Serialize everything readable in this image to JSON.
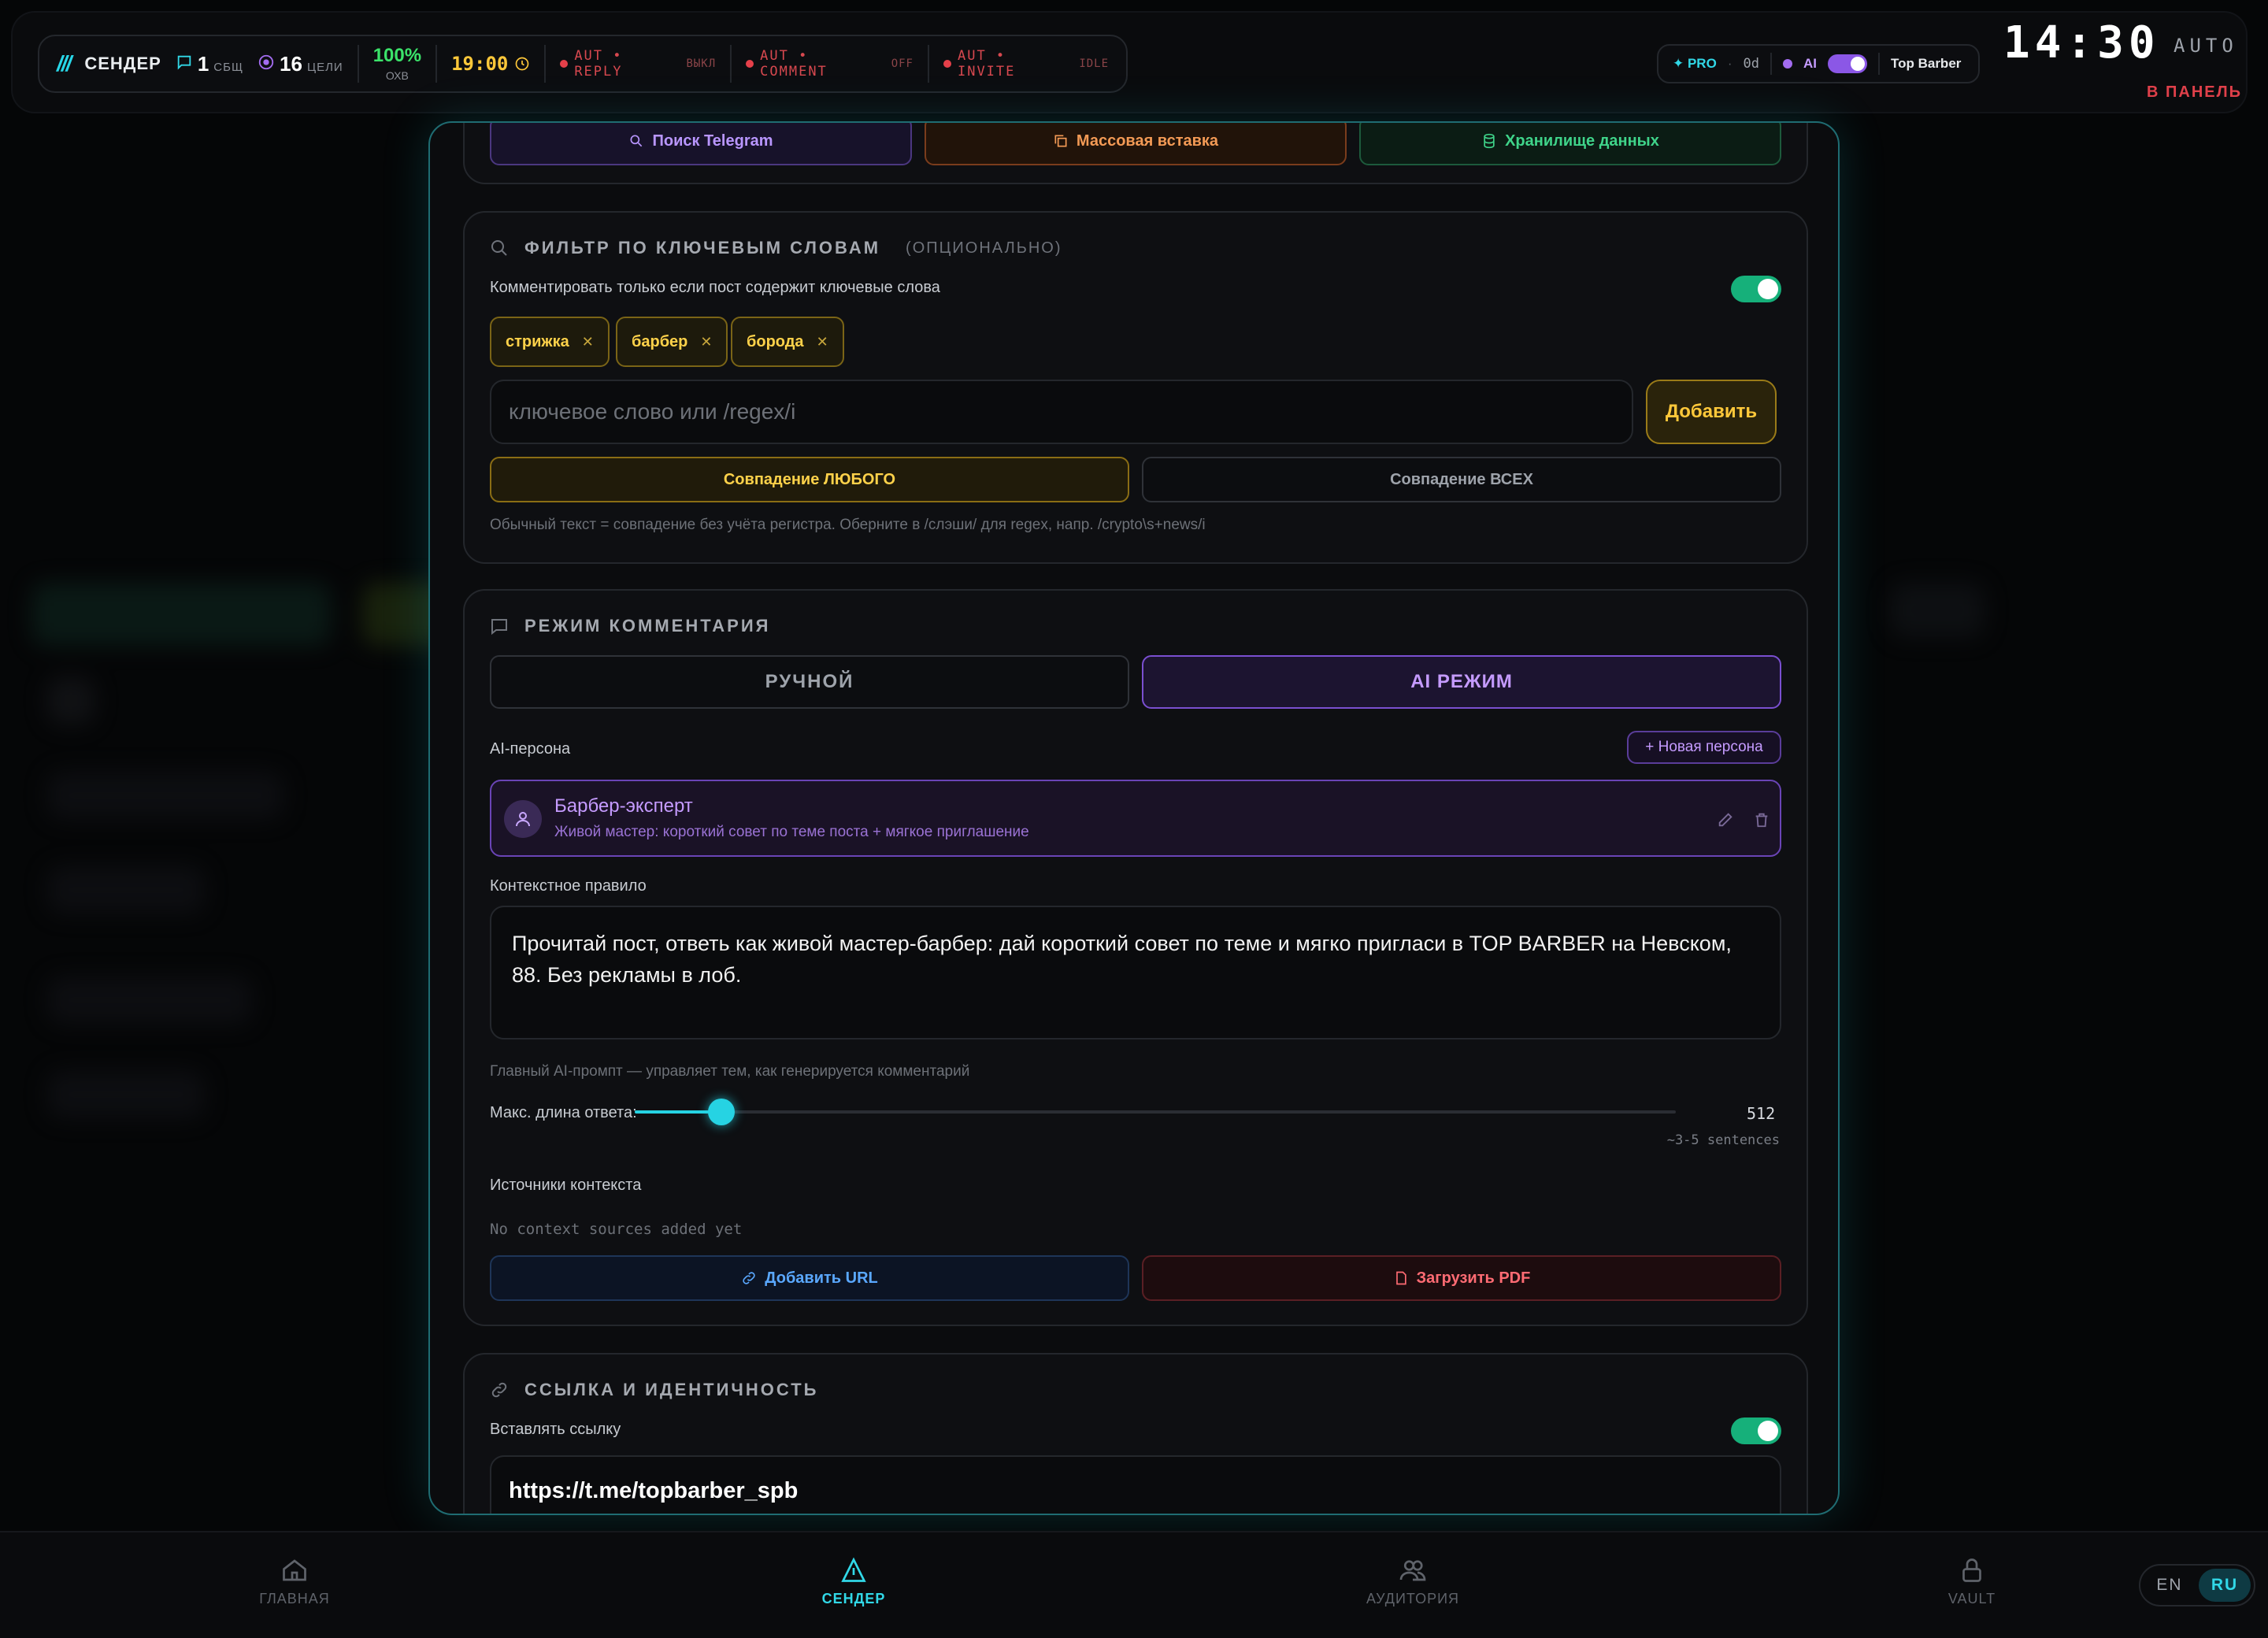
{
  "topbar": {
    "brand_slash": "///",
    "brand": "СЕНДЕР",
    "messages_count": "1",
    "messages_label": "СБЩ",
    "targets_count": "16",
    "targets_label": "ЦЕЛИ",
    "reach_value": "100%",
    "reach_label": "ОХВ",
    "time": "19:00",
    "autos": [
      {
        "label": "AUT • REPLY",
        "state": "ВЫКЛ"
      },
      {
        "label": "AUT • COMMENT",
        "state": "OFF"
      },
      {
        "label": "AUT • INVITE",
        "state": "IDLE"
      }
    ],
    "pro_label": "✦ PRO",
    "pro_days": "0d",
    "ai_label": "AI",
    "account": "Top Barber",
    "clock": "14:30",
    "auto_label": "AUTO",
    "to_panel": "В ПАНЕЛЬ"
  },
  "source_buttons": {
    "telegram": "Поиск Telegram",
    "bulk": "Массовая вставка",
    "storage": "Хранилище данных"
  },
  "keyword_filter": {
    "title": "ФИЛЬТР ПО КЛЮЧЕВЫМ СЛОВАМ",
    "optional": "(ОПЦИОНАЛЬНО)",
    "toggle_label": "Комментировать только если пост содержит ключевые слова",
    "toggle_on": true,
    "tags": [
      "стрижка",
      "барбер",
      "борода"
    ],
    "input_placeholder": "ключевое слово или /regex/i",
    "add_button": "Добавить",
    "match_any": "Совпадение ЛЮБОГО",
    "match_all": "Совпадение ВСЕХ",
    "hint": "Обычный текст = совпадение без учёта регистра. Оберните в /слэши/ для regex, напр. /crypto\\s+news/i"
  },
  "comment_mode": {
    "title": "РЕЖИМ КОММЕНТАРИЯ",
    "manual": "РУЧНОЙ",
    "ai": "AI РЕЖИМ",
    "persona_label": "AI-персона",
    "new_persona": "+ Новая персона",
    "persona_name": "Барбер-эксперт",
    "persona_desc": "Живой мастер: короткий совет по теме поста + мягкое приглашение",
    "rule_label": "Контекстное правило",
    "rule_text": "Прочитай пост, ответь как живой мастер-барбер: дай короткий совет по теме и мягко пригласи в TOP BARBER на Невском, 88. Без рекламы в лоб.",
    "rule_hint": "Главный AI-промпт — управляет тем, как генерируется комментарий",
    "max_len_label": "Макс. длина ответа:",
    "max_len_value": "512",
    "max_len_fraction": 0.05,
    "max_len_hint": "~3-5 sentences",
    "sources_label": "Источники контекста",
    "sources_empty": "No context sources added yet",
    "add_url": "Добавить URL",
    "upload_pdf": "Загрузить PDF"
  },
  "link_identity": {
    "title": "ССЫЛКА И ИДЕНТИЧНОСТЬ",
    "toggle_label": "Вставлять ссылку",
    "toggle_on": true,
    "url": "https://t.me/topbarber_spb"
  },
  "bottom_nav": {
    "home": "ГЛАВНАЯ",
    "sender": "СЕНДЕР",
    "audience": "АУДИТОРИЯ",
    "vault": "VAULT"
  },
  "lang": {
    "en": "EN",
    "ru": "RU"
  },
  "colors": {
    "accent_cyan": "#31d8e7",
    "accent_yellow": "#ffc83a",
    "accent_purple": "#a36cf0",
    "toggle_green": "#16b07a",
    "danger_red": "#e0404a"
  }
}
